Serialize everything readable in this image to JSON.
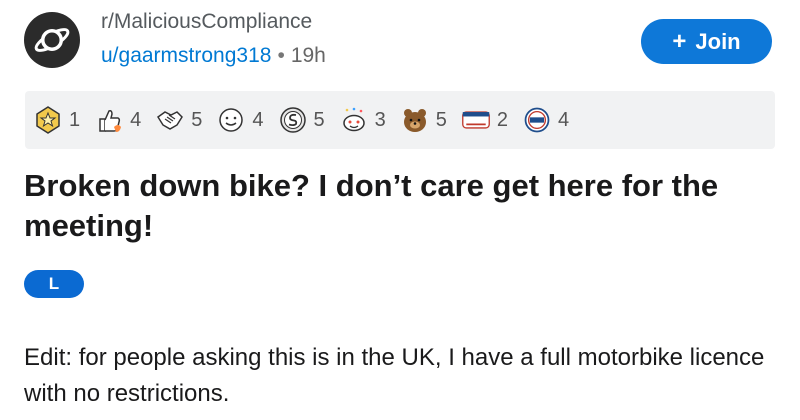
{
  "post": {
    "subreddit": "r/MaliciousCompliance",
    "author": "u/gaarmstrong318",
    "separator": "•",
    "age": "19h",
    "join_label": "Join",
    "title": "Broken down bike? I don’t care get here for the meeting!",
    "flair": "L",
    "body": "Edit: for people asking this is in the UK, I have a full motorbike licence with no restrictions."
  },
  "awards": [
    {
      "icon": "gold-star-award-icon",
      "count": "1",
      "color": "#f2c94c"
    },
    {
      "icon": "thumbs-up-flame-award-icon",
      "count": "4",
      "color": "#ffffff"
    },
    {
      "icon": "handshake-award-icon",
      "count": "5",
      "color": "#ffffff"
    },
    {
      "icon": "smiling-face-award-icon",
      "count": "4",
      "color": "#ffffff"
    },
    {
      "icon": "silver-coin-award-icon",
      "count": "5",
      "color": "#e6e6e6"
    },
    {
      "icon": "confetti-snoo-award-icon",
      "count": "3",
      "color": "#ffffff"
    },
    {
      "icon": "bear-award-icon",
      "count": "5",
      "color": "#8a5a2b"
    },
    {
      "icon": "voted-badge-award-icon",
      "count": "2",
      "color": "#ffffff"
    },
    {
      "icon": "vote-badge-award-icon",
      "count": "4",
      "color": "#ffffff"
    }
  ],
  "colors": {
    "accent": "#0e78d8",
    "user_link": "#0079d3",
    "awards_bar": "#f1f2f3"
  }
}
